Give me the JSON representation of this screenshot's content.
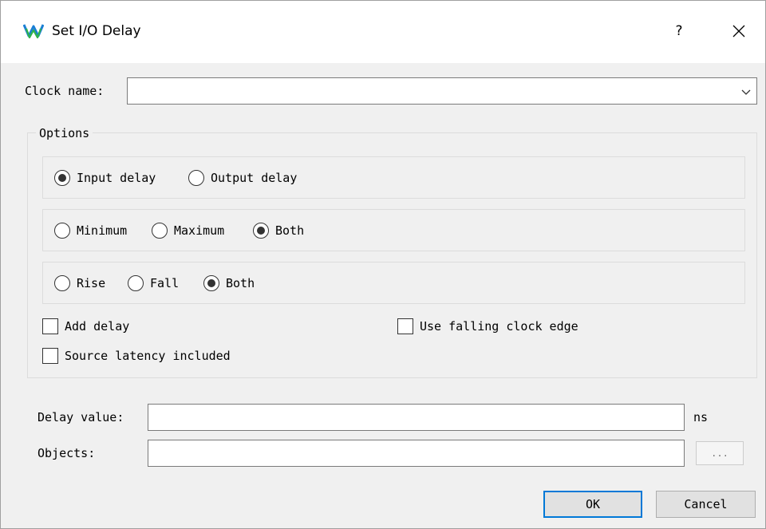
{
  "window": {
    "title": "Set I/O Delay",
    "help_label": "?",
    "icons": {
      "app": "app-logo-icon",
      "close": "close-icon",
      "dropdown": "chevron-down-icon"
    },
    "accent_color": "#0078d7"
  },
  "clock": {
    "label": "Clock name:",
    "value": ""
  },
  "options": {
    "title": "Options",
    "direction": [
      {
        "label": "Input delay",
        "checked": true
      },
      {
        "label": "Output delay",
        "checked": false
      }
    ],
    "range": [
      {
        "label": "Minimum",
        "checked": false
      },
      {
        "label": "Maximum",
        "checked": false
      },
      {
        "label": "Both",
        "checked": true
      }
    ],
    "edge": [
      {
        "label": "Rise",
        "checked": false
      },
      {
        "label": "Fall",
        "checked": false
      },
      {
        "label": "Both",
        "checked": true
      }
    ],
    "add_delay": {
      "label": "Add delay",
      "checked": false
    },
    "use_falling_edge": {
      "label": "Use falling clock edge",
      "checked": false
    },
    "source_latency": {
      "label": "Source latency included",
      "checked": false
    }
  },
  "delay": {
    "label": "Delay value:",
    "value": "",
    "unit": "ns"
  },
  "objects": {
    "label": "Objects:",
    "value": "",
    "browse_label": "..."
  },
  "buttons": {
    "ok": "OK",
    "cancel": "Cancel"
  }
}
